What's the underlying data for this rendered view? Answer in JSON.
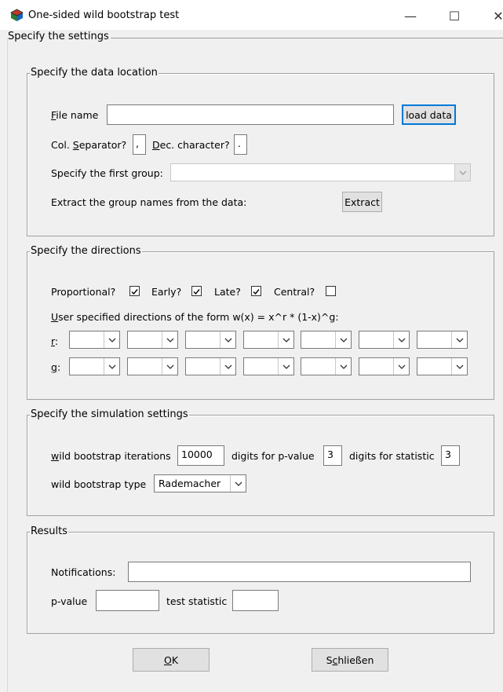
{
  "window": {
    "title": "One-sided wild bootstrap test",
    "minimize": "—",
    "maximize": "☐",
    "close": "✕"
  },
  "settings_legend": "Specify the settings",
  "data_location": {
    "legend": "Specify the data location",
    "file_name_label_u": "F",
    "file_name_label_rest": "ile name",
    "file_name_value": "",
    "load_button": "load data",
    "col_sep_label_a": "Col. ",
    "col_sep_label_u": "S",
    "col_sep_label_b": "eparator?",
    "col_sep_value": ",",
    "dec_label_u": "D",
    "dec_label_b": "ec. character?",
    "dec_value": ".",
    "first_group_label": "Specify the first group:",
    "first_group_value": "",
    "extract_label": "Extract the group names from the data:",
    "extract_button": "Extract"
  },
  "directions": {
    "legend": "Specify the directions",
    "proportional_label": "Proportional?",
    "proportional_checked": true,
    "early_label": "Early?",
    "early_checked": true,
    "late_label": "Late?",
    "late_checked": true,
    "central_label": "Central?",
    "central_checked": false,
    "user_label_u": "U",
    "user_label_b": "ser specified directions of the form w(x) = x^r * (1-x)^g:",
    "r_label_u": "r",
    "r_label_b": ":",
    "g_label_u": "g",
    "g_label_b": ":",
    "r_values": [
      "",
      "",
      "",
      "",
      "",
      "",
      ""
    ],
    "g_values": [
      "",
      "",
      "",
      "",
      "",
      "",
      ""
    ]
  },
  "simulation": {
    "legend": "Specify the simulation settings",
    "iterations_label_u": "w",
    "iterations_label_b": "ild bootstrap iterations",
    "iterations_value": "10000",
    "pvalue_digits_label": "digits for p-value",
    "pvalue_digits_value": "3",
    "stat_digits_label": "digits for statistic",
    "stat_digits_value": "3",
    "type_label": "wild bootstrap type",
    "type_value": "Rademacher"
  },
  "results": {
    "legend": "Results",
    "notifications_label": "Notifications:",
    "notifications_value": "",
    "pvalue_label": "p-value",
    "pvalue_value": "",
    "statistic_label": "test statistic",
    "statistic_value": ""
  },
  "buttons": {
    "ok_u": "O",
    "ok_b": "K",
    "close_a": "S",
    "close_u": "c",
    "close_b": "hließen"
  }
}
